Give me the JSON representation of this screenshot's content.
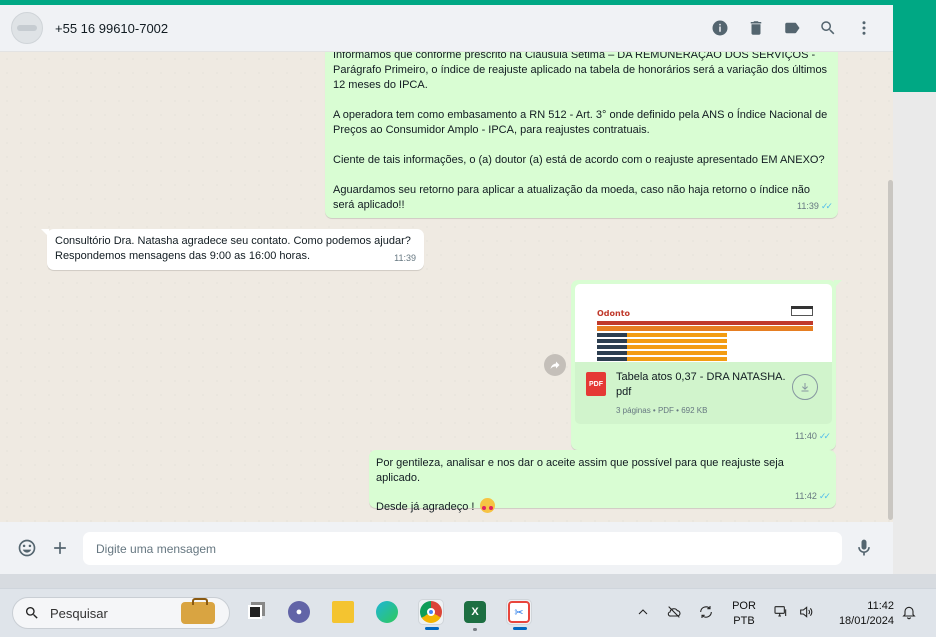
{
  "header": {
    "contact": "+55 16 99610-7002",
    "icons": [
      "info-icon",
      "trash-icon",
      "label-icon",
      "search-icon",
      "more-vertical-icon"
    ]
  },
  "messages": [
    {
      "id": "m1",
      "direction": "out",
      "paragraphs": [
        "Informamos que conforme prescrito na Cláusula Sétima – DA REMUNERAÇÃO DOS SERVIÇOS - Parágrafo Primeiro, o índice de reajuste aplicado na tabela de honorários será a variação dos últimos 12 meses do IPCA.",
        "A operadora tem como embasamento a RN 512 - Art. 3° onde definido pela ANS o Índice Nacional de Preços ao Consumidor Amplo - IPCA, para reajustes contratuais.",
        "Ciente de tais informações, o (a) doutor (a) está de acordo com o reajuste apresentado EM ANEXO?",
        "Aguardamos seu retorno para aplicar a atualização da moeda, caso não haja retorno o índice não será aplicado!!"
      ],
      "time": "11:39"
    },
    {
      "id": "m2",
      "direction": "in",
      "text": "Consultório Dra. Natasha agradece seu contato. Como podemos ajudar? Respondemos mensagens das 9:00 as 16:00 horas.",
      "time": "11:39"
    },
    {
      "id": "m3",
      "direction": "out",
      "file": {
        "icon_label": "PDF",
        "name": "Tabela atos 0,37 - DRA NATASHA.",
        "ext": "pdf",
        "meta": "3 páginas • PDF • 692 KB"
      },
      "time": "11:40"
    },
    {
      "id": "m4",
      "direction": "out",
      "line1": "Por gentileza, analisar e nos dar o aceite assim que possível para que reajuste seja aplicado.",
      "line2": "Desde já agradeço !",
      "time": "11:42"
    }
  ],
  "input": {
    "placeholder": "Digite uma mensagem"
  },
  "taskbar": {
    "search_label": "Pesquisar",
    "lang_line1": "POR",
    "lang_line2": "PTB",
    "time": "11:42",
    "date": "18/01/2024"
  },
  "colors": {
    "accent": "#00a884",
    "outgoing_bubble": "#d9fdd3",
    "incoming_bubble": "#ffffff",
    "read_ticks": "#53bdeb"
  }
}
